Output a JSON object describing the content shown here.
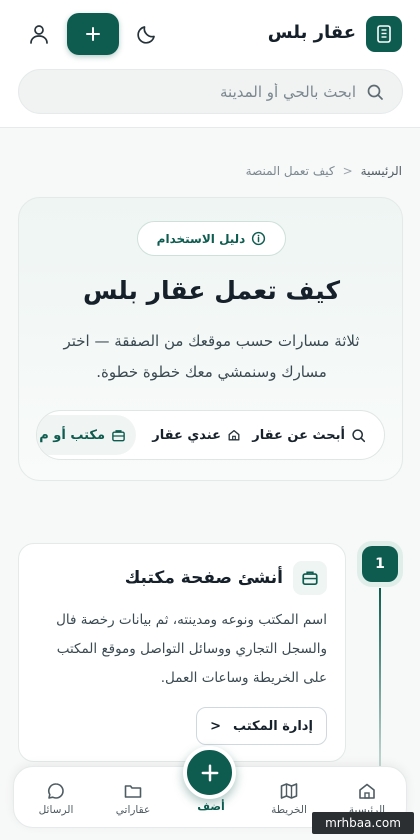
{
  "header": {
    "app_name": "عقار بلس",
    "search_placeholder": "ابحث بالحي أو المدينة"
  },
  "breadcrumb": {
    "home": "الرئيسية",
    "current": "كيف تعمل المنصة",
    "separator": "<"
  },
  "hero": {
    "badge": "دليل الاستخدام",
    "title": "كيف تعمل عقار بلس",
    "description": "ثلاثة مسارات حسب موقعك من الصفقة — اختر مسارك وسنمشي معك خطوة خطوة.",
    "tabs": [
      {
        "label": "أبحث عن عقار",
        "icon": "search-icon"
      },
      {
        "label": "عندي عقار",
        "icon": "home-icon"
      },
      {
        "label": "مكتب أو م",
        "icon": "briefcase-icon",
        "selected": true
      }
    ]
  },
  "steps": [
    {
      "number": "1",
      "title": "أنشئ صفحة مكتبك",
      "description": "اسم المكتب ونوعه ومدينته، ثم بيانات رخصة فال والسجل التجاري ووسائل التواصل وموقع المكتب على الخريطة وساعات العمل.",
      "link_label": "إدارة المكتب",
      "link_arrow": "<",
      "icon": "briefcase-icon"
    }
  ],
  "bottom_nav": {
    "items": [
      {
        "label": "الرئيسية",
        "icon": "home-icon"
      },
      {
        "label": "الخريطة",
        "icon": "map-icon"
      },
      {
        "label": "أضف",
        "icon": "plus-icon"
      },
      {
        "label": "عقاراتي",
        "icon": "folder-icon"
      },
      {
        "label": "الرسائل",
        "icon": "chat-icon"
      }
    ]
  },
  "watermark": "mrhbaa.com",
  "colors": {
    "brand": "#0d5c4f",
    "background": "#f7f8f8",
    "text": "#16202a"
  }
}
